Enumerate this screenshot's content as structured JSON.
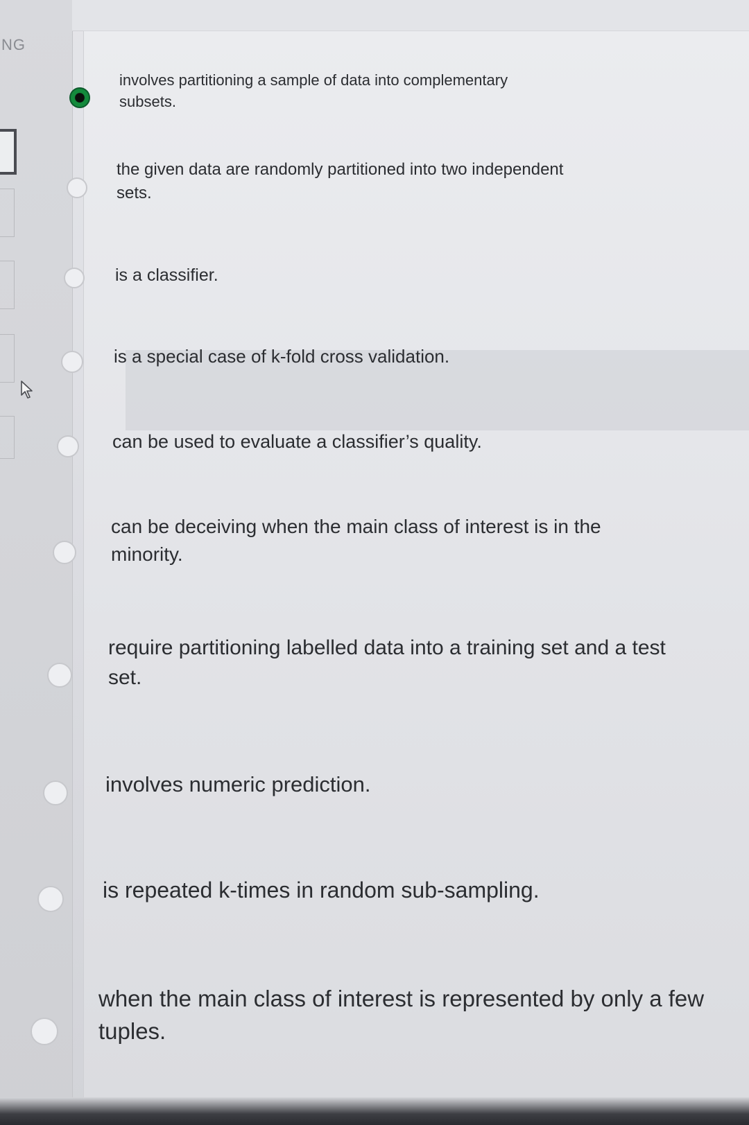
{
  "sidebar": {
    "section_label": "NG"
  },
  "question": {
    "options": [
      {
        "text": "involves partitioning a sample of data into complementary subsets.",
        "selected": true
      },
      {
        "text": "the given data are randomly partitioned into two independent sets.",
        "selected": false
      },
      {
        "text": "is a classifier.",
        "selected": false
      },
      {
        "text": "is a special case of k-fold cross validation.",
        "selected": false
      },
      {
        "text": "can be used to evaluate a classifier’s quality.",
        "selected": false
      },
      {
        "text": "can be deceiving when the main class of interest is in the minority.",
        "selected": false
      },
      {
        "text": "require partitioning labelled data into a training set and a test set.",
        "selected": false
      },
      {
        "text": "involves numeric prediction.",
        "selected": false
      },
      {
        "text": "is repeated k-times in random sub-sampling.",
        "selected": false
      },
      {
        "text": "when the main class of interest is represented by only a few tuples.",
        "selected": false
      }
    ]
  }
}
